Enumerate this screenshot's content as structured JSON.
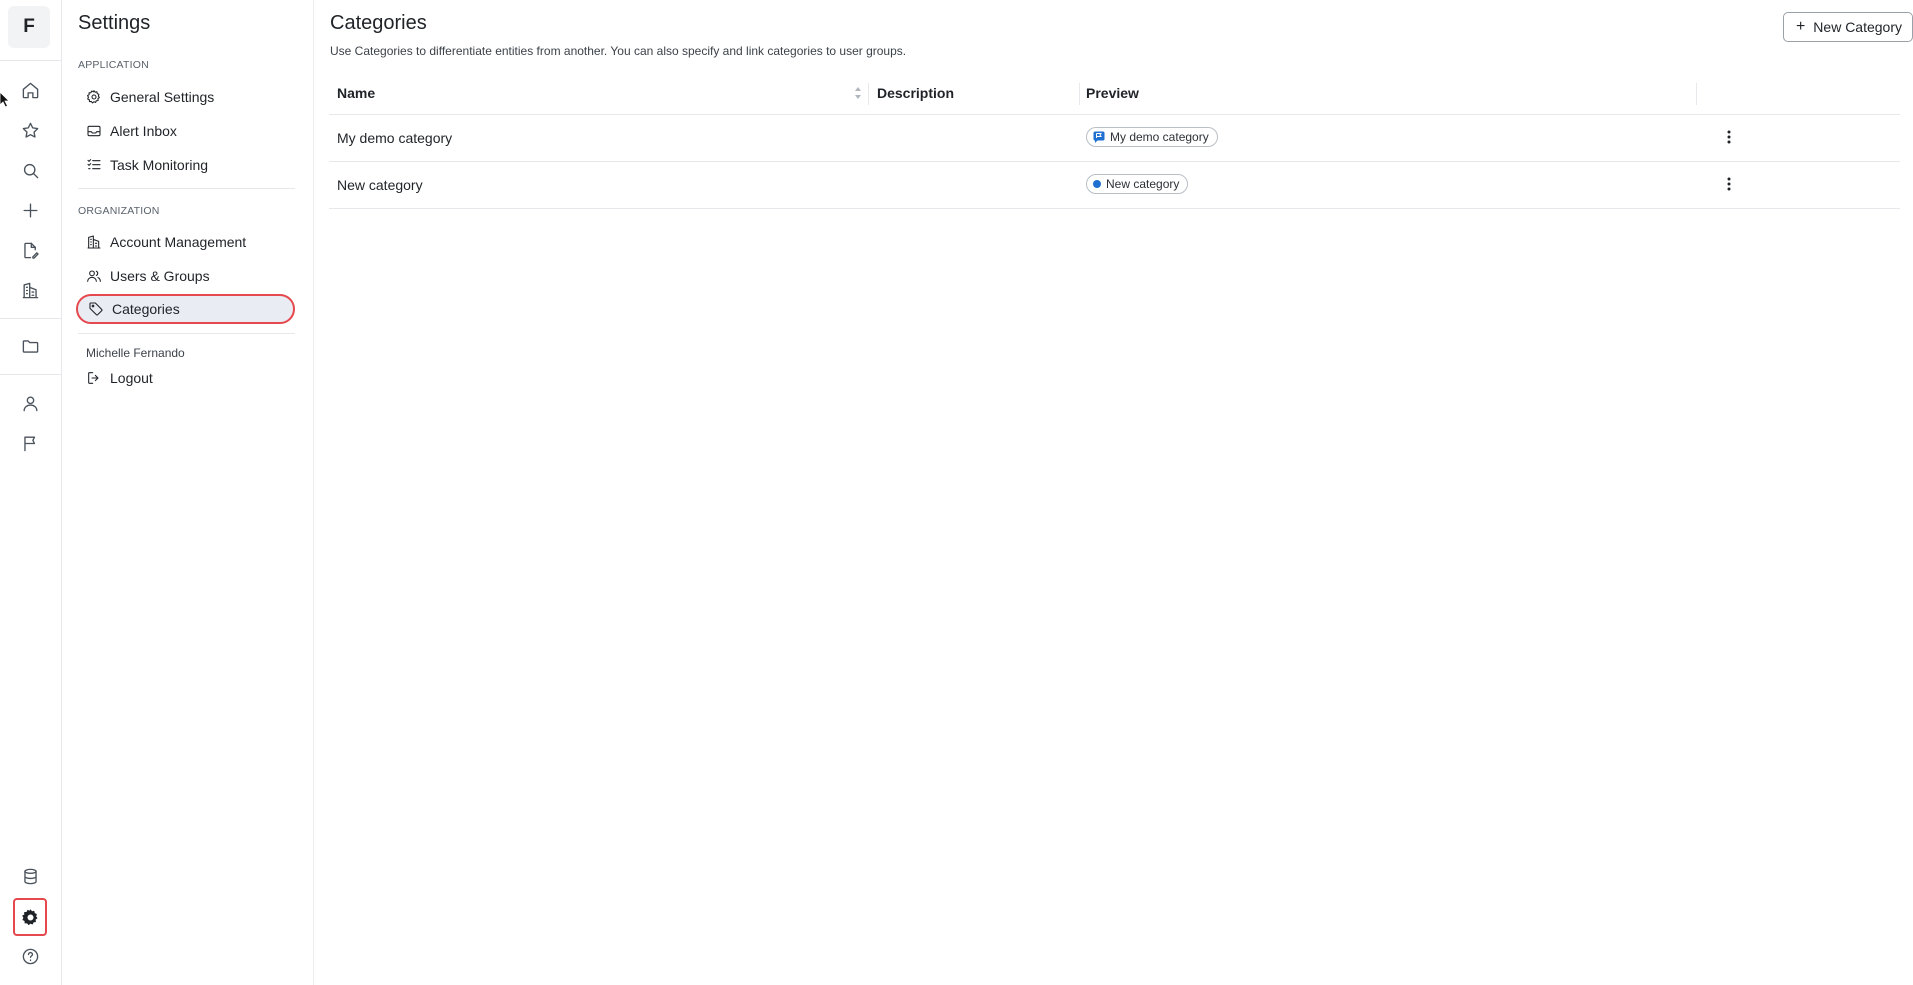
{
  "app": {
    "logo_letter": "F"
  },
  "rail": {
    "icons": [
      "home-icon",
      "star-icon",
      "search-icon",
      "plus-icon",
      "file-edit-icon",
      "buildings-icon",
      "folder-icon",
      "user-icon",
      "flag-icon",
      "database-icon",
      "gear-icon",
      "help-circle-icon"
    ],
    "active": "gear-icon",
    "highlight_color": "#e5484d"
  },
  "settings": {
    "title": "Settings",
    "application_label": "APPLICATION",
    "application_items": [
      {
        "label": "General Settings",
        "icon": "gear-outline-icon"
      },
      {
        "label": "Alert Inbox",
        "icon": "inbox-icon"
      },
      {
        "label": "Task Monitoring",
        "icon": "list-check-icon"
      }
    ],
    "organization_label": "ORGANIZATION",
    "organization_items": [
      {
        "label": "Account Management",
        "icon": "buildings-icon"
      },
      {
        "label": "Users & Groups",
        "icon": "users-icon"
      },
      {
        "label": "Categories",
        "icon": "tag-icon",
        "active": true
      }
    ],
    "user_name": "Michelle Fernando",
    "logout_label": "Logout"
  },
  "main": {
    "title": "Categories",
    "description": "Use Categories to differentiate entities from another. You can also specify and link categories to user groups.",
    "new_button_label": "New Category",
    "columns": [
      "Name",
      "Description",
      "Preview"
    ],
    "rows": [
      {
        "name": "My demo category",
        "description": "",
        "preview_label": "My demo category",
        "preview_icon": "flag-badge-icon",
        "preview_color": "#1f6fd0"
      },
      {
        "name": "New category",
        "description": "",
        "preview_label": "New category",
        "preview_icon": "dot-icon",
        "preview_color": "#1f6fd0"
      }
    ]
  }
}
